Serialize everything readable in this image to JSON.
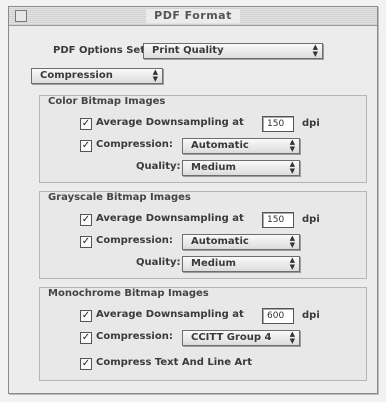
{
  "window": {
    "title": "PDF Format"
  },
  "pdf_options_set": {
    "label": "PDF Options Set:",
    "value": "Print Quality"
  },
  "panel_menu": {
    "value": "Compression"
  },
  "color": {
    "heading": "Color Bitmap Images",
    "downsample_label": "Average Downsampling at",
    "dpi_value": "150",
    "dpi_unit": "dpi",
    "compression_label": "Compression:",
    "compression_value": "Automatic",
    "quality_label": "Quality:",
    "quality_value": "Medium"
  },
  "grayscale": {
    "heading": "Grayscale Bitmap Images",
    "downsample_label": "Average Downsampling at",
    "dpi_value": "150",
    "dpi_unit": "dpi",
    "compression_label": "Compression:",
    "compression_value": "Automatic",
    "quality_label": "Quality:",
    "quality_value": "Medium"
  },
  "monochrome": {
    "heading": "Monochrome Bitmap Images",
    "downsample_label": "Average Downsampling at",
    "dpi_value": "600",
    "dpi_unit": "dpi",
    "compression_label": "Compression:",
    "compression_value": "CCITT Group 4"
  },
  "compress_text": {
    "label": "Compress Text And Line Art"
  },
  "icons": {
    "check": "check-mark",
    "popup_arrows": "up-down-arrows"
  }
}
